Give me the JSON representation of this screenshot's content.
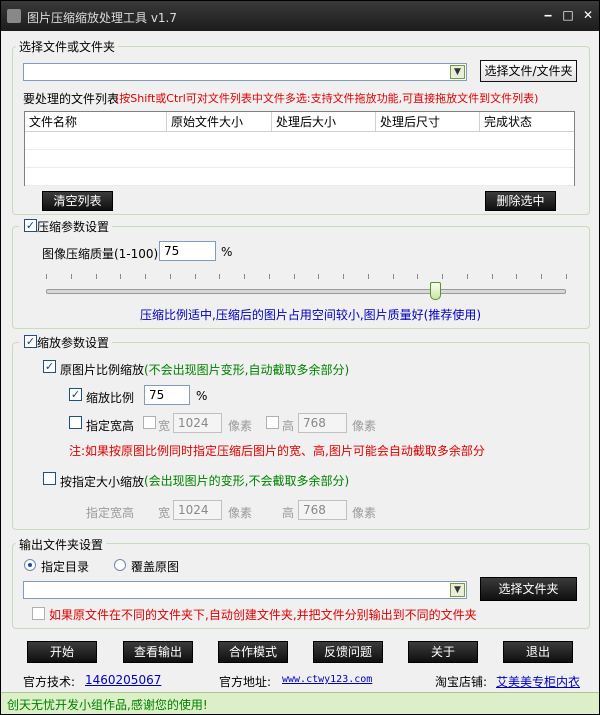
{
  "window": {
    "title": "图片压缩缩放处理工具 v1.7",
    "min_label": "‒",
    "max_label": "□",
    "close_label": "✕"
  },
  "files": {
    "group_label": "选择文件或文件夹",
    "select_button": "选择文件/文件夹",
    "list_label": "要处理的文件列表",
    "list_hint": "(按Shift或Ctrl可对文件列表中文件多选:支持文件拖放功能,可直接拖放文件到文件列表)",
    "columns": [
      "文件名称",
      "原始文件大小",
      "处理后大小",
      "处理后尺寸",
      "完成状态"
    ],
    "clear_button": "清空列表",
    "delete_button": "删除选中"
  },
  "compress": {
    "group_label": "压缩参数设置",
    "enabled": true,
    "quality_label": "图像压缩质量(1-100):",
    "quality_value": "75",
    "percent": "%",
    "slider_value": 75,
    "hint": "压缩比例适中,压缩后的图片占用空间较小,图片质量好(推荐使用)"
  },
  "scale": {
    "group_label": "缩放参数设置",
    "enabled": true,
    "ratio_mode_label": "原图片比例缩放",
    "ratio_mode_hint": "(不会出现图片变形,自动截取多余部分)",
    "ratio_label": "缩放比例",
    "ratio_value": "75",
    "percent": "%",
    "wh_label": "指定宽高",
    "width_label": "宽",
    "width_value": "1024",
    "height_label": "高",
    "height_value": "768",
    "pixel_unit": "像素",
    "note": "注:如果按原图比例同时指定压缩后图片的宽、高,图片可能会自动截取多余部分",
    "size_mode_label": "按指定大小缩放",
    "size_mode_hint": "(会出现图片的变形,不会截取多余部分)",
    "size_wh_label": "指定宽高",
    "size_width_label": "宽",
    "size_width_value": "1024",
    "size_height_label": "高",
    "size_height_value": "768"
  },
  "output": {
    "group_label": "输出文件夹设置",
    "radio_dir": "指定目录",
    "radio_overwrite": "覆盖原图",
    "select_folder_button": "选择文件夹",
    "separate_label": "如果原文件在不同的文件夹下,自动创建文件夹,并把文件分别输出到不同的文件夹"
  },
  "actions": [
    "开始",
    "查看输出",
    "合作模式",
    "反馈问题",
    "关于",
    "退出"
  ],
  "footer": {
    "support_label": "官方技术:",
    "support_value": "1460205067",
    "site_label": "官方地址:",
    "site_value": "www.ctwy123.com",
    "shop_label": "淘宝店铺:",
    "shop_value": "艾美美专柜内衣",
    "status": "创天无忧开发小组作品,感谢您的使用!"
  }
}
